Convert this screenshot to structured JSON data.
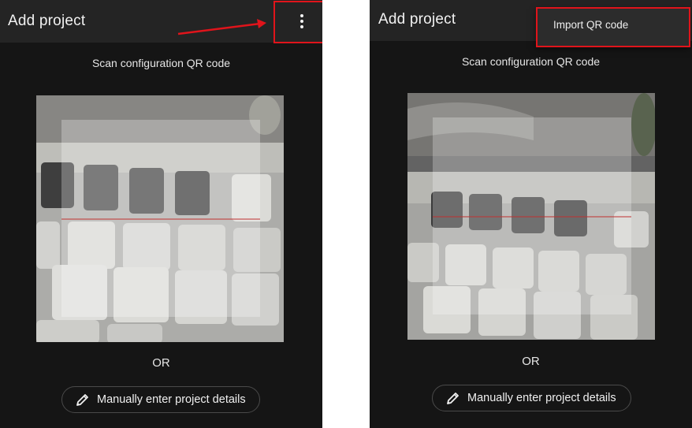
{
  "left_panel": {
    "title": "Add project",
    "overflow_icon": "more-vert-icon",
    "scan_label": "Scan configuration QR code",
    "or_text": "OR",
    "manual_button": {
      "icon": "pencil-icon",
      "label": "Manually enter project details"
    }
  },
  "right_panel": {
    "title": "Add project",
    "menu": {
      "items": [
        {
          "label": "Import QR code"
        }
      ]
    },
    "scan_label": "Scan configuration QR code",
    "or_text": "OR",
    "manual_button": {
      "icon": "pencil-icon",
      "label": "Manually enter project details"
    }
  },
  "annotation_color": "#e0141b"
}
